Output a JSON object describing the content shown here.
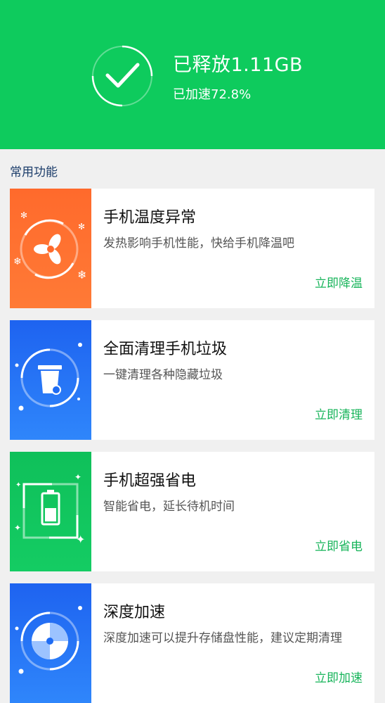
{
  "header": {
    "title": "已释放1.11GB",
    "subtitle": "已加速72.8%",
    "bg_color": "#0ecb5d",
    "icon": "check-circle-icon"
  },
  "section": {
    "title": "常用功能"
  },
  "features": [
    {
      "title": "手机温度异常",
      "desc": "发热影响手机性能，快给手机降温吧",
      "action": "立即降温",
      "icon": "fan-icon",
      "color": "#ff6a2c"
    },
    {
      "title": "全面清理手机垃圾",
      "desc": "一键清理各种隐藏垃圾",
      "action": "立即清理",
      "icon": "trash-icon",
      "color": "#1f6cf3"
    },
    {
      "title": "手机超强省电",
      "desc": "智能省电，延长待机时间",
      "action": "立即省电",
      "icon": "battery-icon",
      "color": "#11c45c"
    },
    {
      "title": "深度加速",
      "desc": "深度加速可以提升存储盘性能，建议定期清理",
      "action": "立即加速",
      "icon": "disk-icon",
      "color": "#1f6cf3"
    }
  ],
  "colors": {
    "accent": "#17b45a",
    "background": "#f0f0f0"
  }
}
